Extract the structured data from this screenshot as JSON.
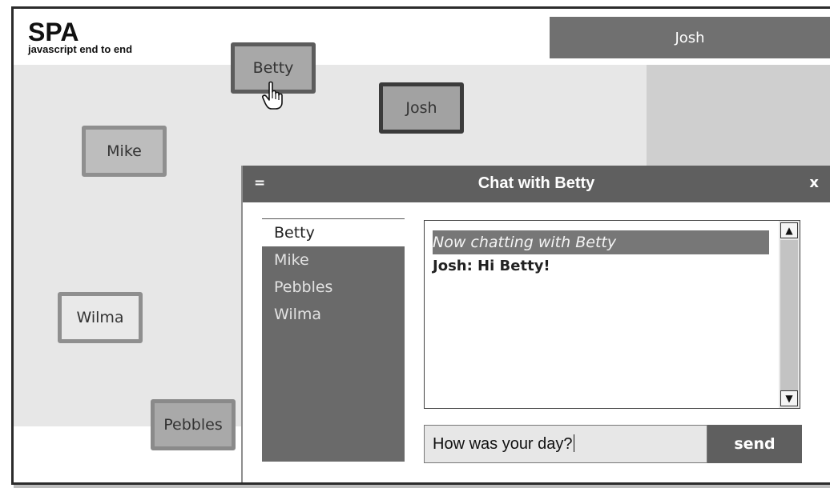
{
  "logo": {
    "title": "SPA",
    "subtitle": "javascript end to end"
  },
  "account": {
    "name": "Josh"
  },
  "avatars": [
    {
      "id": "betty",
      "label": "Betty"
    },
    {
      "id": "josh",
      "label": "Josh"
    },
    {
      "id": "mike",
      "label": "Mike"
    },
    {
      "id": "wilma",
      "label": "Wilma"
    },
    {
      "id": "pebbles",
      "label": "Pebbles"
    }
  ],
  "chat": {
    "menu_icon": "=",
    "title": "Chat with Betty",
    "close_label": "x",
    "roster": [
      "Betty",
      "Mike",
      "Pebbles",
      "Wilma"
    ],
    "selected_person": "Betty",
    "messages": {
      "system_note": "Now chatting with Betty",
      "line": "Josh: Hi Betty!"
    },
    "input_value": "How was your day?",
    "send_label": "send"
  },
  "icons": {
    "cursor": "hand-pointer-icon",
    "scroll_up": "arrow-up-icon",
    "scroll_down": "arrow-down-icon"
  }
}
